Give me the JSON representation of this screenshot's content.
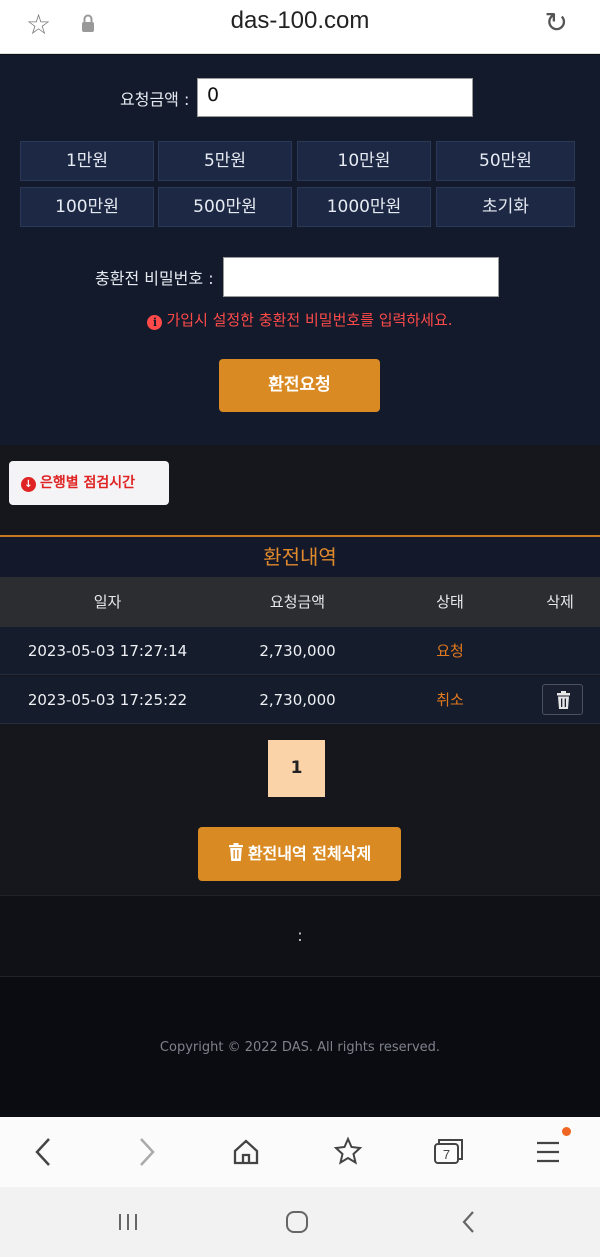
{
  "browser": {
    "url": "das-100.com",
    "tab_count": "7"
  },
  "form": {
    "amount_label": "요청금액 :",
    "amount_value": "0",
    "quick_buttons": [
      "1만원",
      "5만원",
      "10만원",
      "50만원",
      "100만원",
      "500만원",
      "1000만원",
      "초기화"
    ],
    "password_label": "충환전 비밀번호 :",
    "password_value": "",
    "warning": "가입시 설정한 충환전 비밀번호를 입력하세요.",
    "submit_label": "환전요청"
  },
  "bank_button": {
    "label": "은행별 점검시간"
  },
  "history": {
    "title": "환전내역",
    "columns": [
      "일자",
      "요청금액",
      "상태",
      "삭제"
    ],
    "rows": [
      {
        "date": "2023-05-03 17:27:14",
        "amount": "2,730,000",
        "status": "요청"
      },
      {
        "date": "2023-05-03 17:25:22",
        "amount": "2,730,000",
        "status": "취소"
      }
    ],
    "page": "1",
    "delete_all_label": "환전내역 전체삭제"
  },
  "footer": {
    "separator": ":",
    "copyright": "Copyright © 2022 DAS. All rights reserved."
  },
  "colors": {
    "accent": "#d98a22",
    "form_bg": "#131a2b",
    "warning": "#ff4a4a"
  }
}
